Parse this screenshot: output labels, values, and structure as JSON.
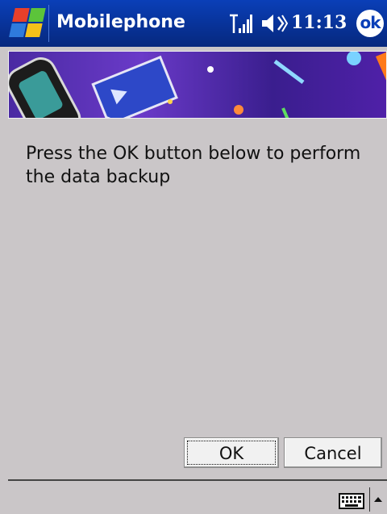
{
  "header": {
    "app_title": "Mobilephone",
    "clock": "11:13",
    "ok_label": "ok"
  },
  "icons": {
    "start": "windows-flag-icon",
    "signal": "signal-strength-icon",
    "volume": "speaker-icon",
    "ok": "ok-icon",
    "keyboard": "keyboard-icon",
    "input_menu": "up-arrow-icon"
  },
  "main": {
    "message": "Press the OK button below to perform the data backup"
  },
  "buttons": {
    "ok_label": "OK",
    "cancel_label": "Cancel"
  },
  "colors": {
    "titlebar": "#0a3fb8",
    "background": "#cac6c8",
    "banner": "#4a2aa2"
  }
}
